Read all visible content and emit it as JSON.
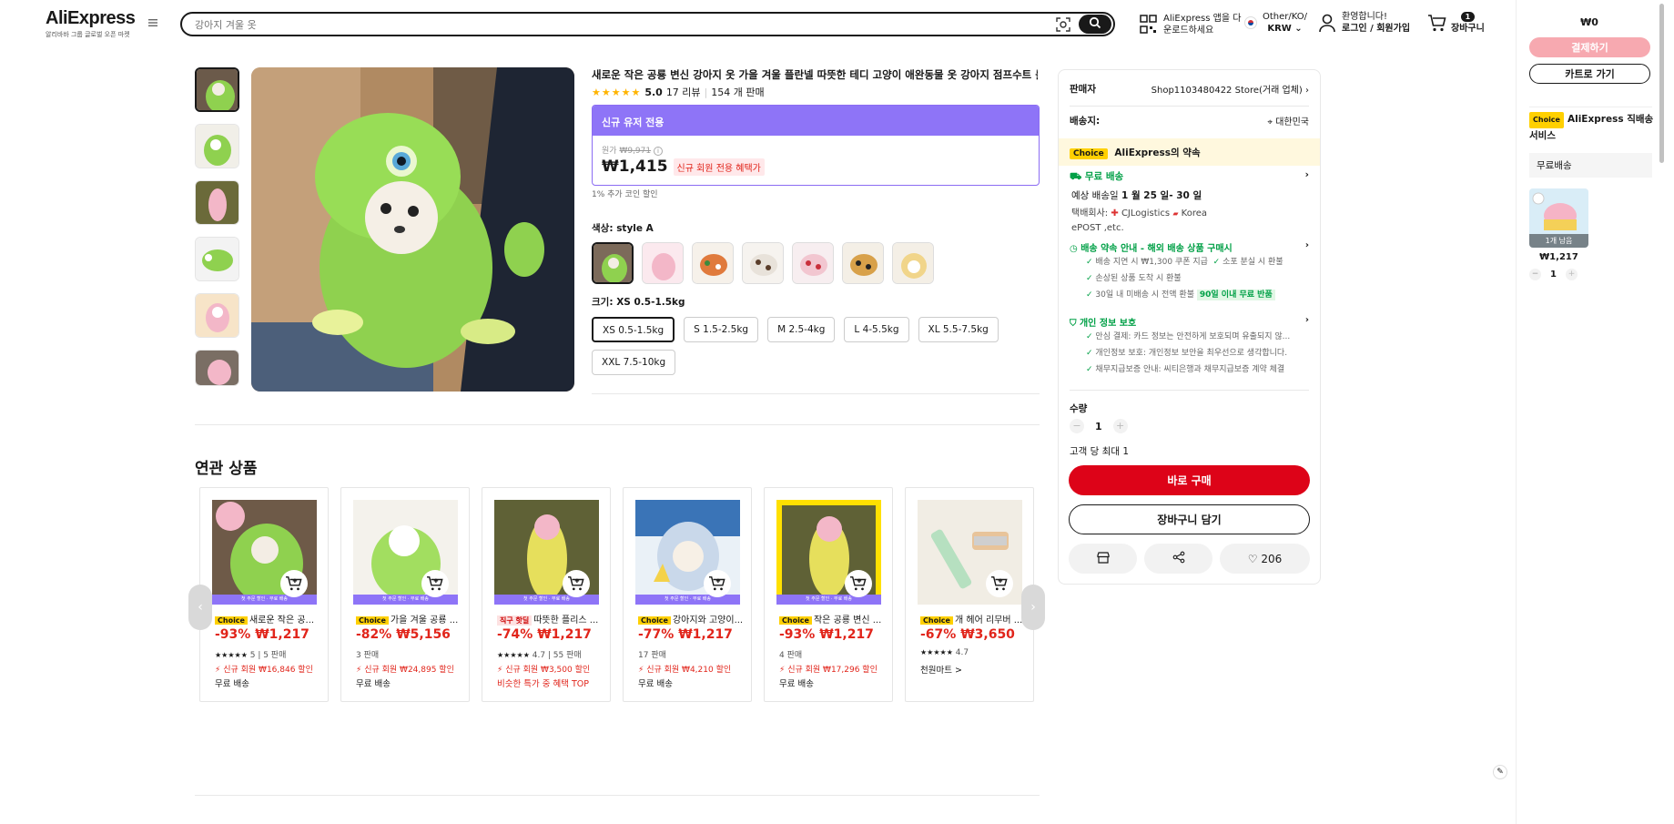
{
  "header": {
    "logo": "AliExpress",
    "logo_sub": "알리바바 그룹 글로벌 오픈 마켓",
    "search_placeholder": "강아지 겨울 옷",
    "app_line1": "AliExpress 앱을 다",
    "app_line2": "운로드하세요",
    "region_line1": "Other/KO/",
    "region_line2": "KRW",
    "account_line1": "환영합니다!",
    "account_line2": "로그인 / 회원가입",
    "cart_count": "1",
    "cart_label": "장바구니"
  },
  "product": {
    "title": "새로운 작은 공룡 변신 강아지 옷 가을 겨울 플란넬 따뜻한 테디 고양이 애완동물 옷 강아지 점프수트 룰퍼",
    "rating": "5.0",
    "reviews": "17 리뷰",
    "sold": "154 개 판매",
    "promo_header": "신규 유저 전용",
    "orig_label": "원가",
    "orig_price": "₩9,971",
    "price": "₩1,415",
    "price_tag": "신규 회원 전용 혜택가",
    "coin_note": "1% 추가 코인 할인",
    "color_label": "색상:",
    "color_value": "style A",
    "size_label": "크기:",
    "size_value": "XS 0.5-1.5kg",
    "sizes": [
      "XS 0.5-1.5kg",
      "S 1.5-2.5kg",
      "M 2.5-4kg",
      "L 4-5.5kg",
      "XL 5.5-7.5kg",
      "XXL 7.5-10kg"
    ]
  },
  "panel": {
    "seller_label": "판매자",
    "seller_name": "Shop1103480422 Store(거래 업체)",
    "ship_to_label": "배송지:",
    "ship_to": "대한민국",
    "choice_badge": "Choice",
    "choice_text": "AliExpress의 약속",
    "free_shipping": "무료 배송",
    "delivery_label": "예상 배송일",
    "delivery_dates": "1 월 25 일- 30 일",
    "courier_label": "택배회사:",
    "courier": "CJLogistics",
    "courier2": "Korea",
    "courier3": "ePOST ,etc.",
    "promise_title": "배송 약속 안내 - 해외 배송 상품 구매시",
    "promise_items": [
      "배송 지연 시 ₩1,300 쿠폰 지급",
      "소포 분실 시 환불",
      "손상된 상품 도착 시 환불",
      "30일 내 미배송 시 전액 환불"
    ],
    "promise_badge": "90일 이내 무료 반품",
    "privacy_title": "개인 정보 보호",
    "privacy_items": [
      "안심 결제: 카드 정보는 안전하게 보호되며 유출되지 않...",
      "개인정보 보호: 개인정보 보안을 최우선으로 생각합니다.",
      "채무지급보증 안내: 씨티은행과 채무지급보증 계약 체결"
    ],
    "qty_label": "수량",
    "qty": "1",
    "max_note": "고객 당 최대 1",
    "buy_now": "바로 구매",
    "add_cart": "장바구니 담기",
    "wish_count": "206"
  },
  "related": {
    "title": "연관 상품",
    "cards": [
      {
        "tag": "Choice",
        "tag_type": "choice",
        "name": "새로운 작은 공...",
        "price": "-93% ₩1,217",
        "rating": "5 | 5 판매",
        "deal": "신규 회원 ₩16,846 할인",
        "ship": "무료 배송",
        "band": "첫 주문 할인 · 무료 배송"
      },
      {
        "tag": "Choice",
        "tag_type": "choice",
        "name": "가을 겨울 공룡 ...",
        "price": "-82% ₩5,156",
        "rating": "3 판매",
        "deal": "신규 회원 ₩24,895 할인",
        "ship": "무료 배송",
        "band": "첫 주문 할인 · 무료 배송"
      },
      {
        "tag": "직구 핫딜",
        "tag_type": "hot",
        "name": "따뜻한 플리스 ...",
        "price": "-74% ₩1,217",
        "rating": "4.7 | 55 판매",
        "deal": "신규 회원 ₩3,500 할인",
        "ship": "비슷한 특가 중 혜택 TOP",
        "band": "첫 주문 할인 · 무료 배송"
      },
      {
        "tag": "Choice",
        "tag_type": "choice",
        "name": "강아지와 고양이...",
        "price": "-77% ₩1,217",
        "rating": "17 판매",
        "deal": "신규 회원 ₩4,210 할인",
        "ship": "무료 배송",
        "band": "첫 주문 할인 · 무료 배송"
      },
      {
        "tag": "Choice",
        "tag_type": "choice",
        "name": "작은 공룡 변신 ...",
        "price": "-93% ₩1,217",
        "rating": "4 판매",
        "deal": "신규 회원 ₩17,296 할인",
        "ship": "무료 배송",
        "band": "첫 주문 할인 · 무료 배송"
      },
      {
        "tag": "Choice",
        "tag_type": "choice",
        "name": "개 헤어 리무버 ...",
        "price": "-67% ₩3,650",
        "rating": "4.7",
        "deal": "",
        "ship": "천원마트 >",
        "band": ""
      }
    ]
  },
  "sidebar": {
    "total": "₩0",
    "checkout": "결제하기",
    "go_cart": "카트로 가기",
    "choice_badge": "Choice",
    "service_title": "AliExpress 직배송 서비스",
    "free": "무료배송",
    "item_count": "1개 남음",
    "item_price": "₩1,217",
    "item_qty": "1"
  },
  "colors": {
    "accent_red": "#dd0318",
    "purple": "#8e74f7",
    "choice_yellow": "#ffd000",
    "green": "#00a046"
  }
}
